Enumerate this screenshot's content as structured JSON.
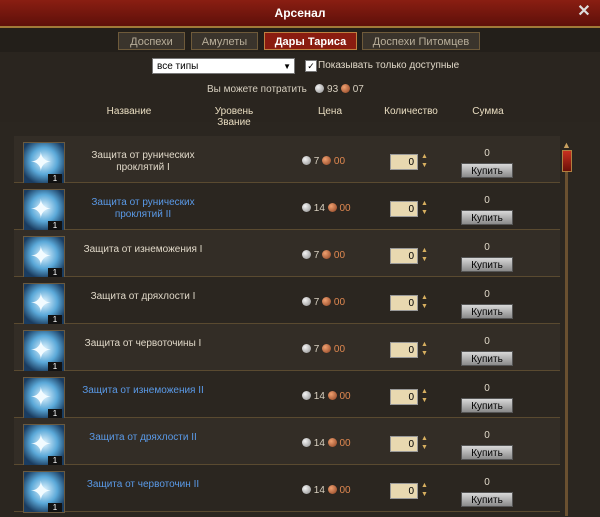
{
  "title": "Арсенал",
  "tabs": [
    {
      "label": "Доспехи",
      "active": false
    },
    {
      "label": "Амулеты",
      "active": false
    },
    {
      "label": "Дары Тариса",
      "active": true
    },
    {
      "label": "Доспехи Питомцев",
      "active": false
    }
  ],
  "filter": {
    "type_value": "все типы",
    "only_available_label": "Показывать только доступные",
    "only_available_checked": true
  },
  "spend": {
    "label": "Вы можете потратить",
    "silver": "93",
    "copper": "07"
  },
  "columns": {
    "name": "Название",
    "level": "Уровень",
    "rank": "Звание",
    "price": "Цена",
    "quantity": "Количество",
    "sum": "Сумма"
  },
  "buy_label": "Купить",
  "items": [
    {
      "count": "1",
      "name": "Защита от рунических проклятий I",
      "blue": false,
      "silver": "7",
      "copper": "00",
      "qty": "0",
      "sum": "0"
    },
    {
      "count": "1",
      "name": "Защита от рунических проклятий II",
      "blue": true,
      "silver": "14",
      "copper": "00",
      "qty": "0",
      "sum": "0"
    },
    {
      "count": "1",
      "name": "Защита от изнеможения I",
      "blue": false,
      "silver": "7",
      "copper": "00",
      "qty": "0",
      "sum": "0"
    },
    {
      "count": "1",
      "name": "Защита от дряхлости I",
      "blue": false,
      "silver": "7",
      "copper": "00",
      "qty": "0",
      "sum": "0"
    },
    {
      "count": "1",
      "name": "Защита от червоточины I",
      "blue": false,
      "silver": "7",
      "copper": "00",
      "qty": "0",
      "sum": "0"
    },
    {
      "count": "1",
      "name": "Защита от изнеможения II",
      "blue": true,
      "silver": "14",
      "copper": "00",
      "qty": "0",
      "sum": "0"
    },
    {
      "count": "1",
      "name": "Защита от дряхлости II",
      "blue": true,
      "silver": "14",
      "copper": "00",
      "qty": "0",
      "sum": "0"
    },
    {
      "count": "1",
      "name": "Защита от червоточин II",
      "blue": true,
      "silver": "14",
      "copper": "00",
      "qty": "0",
      "sum": "0"
    }
  ]
}
